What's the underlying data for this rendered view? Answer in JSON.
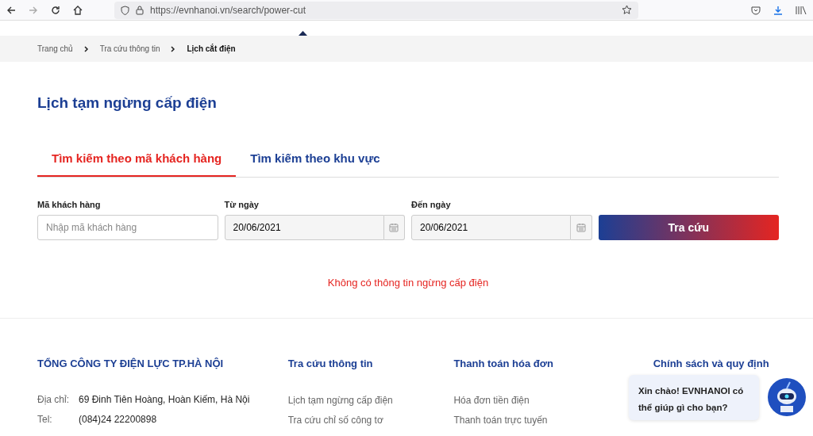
{
  "browser": {
    "url": "https://evnhanoi.vn/search/power-cut"
  },
  "breadcrumb": [
    {
      "label": "Trang chủ",
      "current": false
    },
    {
      "label": "Tra cứu thông tin",
      "current": false
    },
    {
      "label": "Lịch cắt điện",
      "current": true
    }
  ],
  "page_title": "Lịch tạm ngừng cấp điện",
  "tabs": [
    {
      "label": "Tìm kiếm theo mã khách hàng",
      "selected": true
    },
    {
      "label": "Tìm kiếm theo khu vực",
      "selected": false
    }
  ],
  "form": {
    "fields": [
      {
        "kind": "text",
        "label": "Mã khách hàng",
        "placeholder": "Nhập mã khách hàng"
      },
      {
        "kind": "date",
        "label": "Từ ngày",
        "value": "20/06/2021"
      },
      {
        "kind": "date",
        "label": "Đến ngày",
        "value": "20/06/2021"
      }
    ],
    "button": "Tra cứu"
  },
  "message": "Không có thông tin ngừng cấp điện",
  "footer": {
    "company": {
      "title": "TỔNG CÔNG TY ĐIỆN LỰC TP.HÀ NỘI",
      "rows": [
        {
          "label": "Địa chỉ:",
          "value": "69 Đinh Tiên Hoàng, Hoàn Kiếm, Hà Nội"
        },
        {
          "label": "Tel:",
          "value": "(084)24 22200898"
        }
      ]
    },
    "columns": [
      {
        "title": "Tra cứu thông tin",
        "links": [
          "Lịch tạm ngừng cấp điện",
          "Tra cứu chỉ số công tơ"
        ]
      },
      {
        "title": "Thanh toán hóa đơn",
        "links": [
          "Hóa đơn tiền điện",
          "Thanh toán trực tuyến"
        ]
      },
      {
        "title": "Chính sách và quy định"
      }
    ]
  },
  "chat": {
    "greeting": "Xin chào! EVNHANOI có thể giúp gì cho bạn?"
  }
}
